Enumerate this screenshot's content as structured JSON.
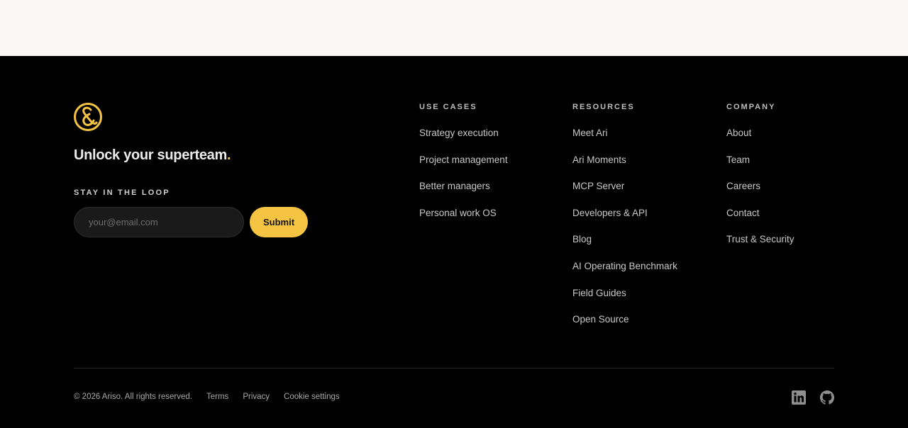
{
  "brand": {
    "tagline": "Unlock your superteam",
    "tagline_dot": ".",
    "accent": "#f5c443"
  },
  "newsletter": {
    "label": "STAY IN THE LOOP",
    "placeholder": "your@email.com",
    "submit_label": "Submit"
  },
  "columns": {
    "use_cases": {
      "heading": "USE CASES",
      "items": [
        "Strategy execution",
        "Project management",
        "Better managers",
        "Personal work OS"
      ]
    },
    "resources": {
      "heading": "RESOURCES",
      "items": [
        "Meet Ari",
        "Ari Moments",
        "MCP Server",
        "Developers & API",
        "Blog",
        "AI Operating Benchmark",
        "Field Guides",
        "Open Source"
      ]
    },
    "company": {
      "heading": "COMPANY",
      "items": [
        "About",
        "Team",
        "Careers",
        "Contact",
        "Trust & Security"
      ]
    }
  },
  "legal": {
    "copyright": "© 2026 Ariso. All rights reserved.",
    "links": [
      "Terms",
      "Privacy",
      "Cookie settings"
    ]
  },
  "social": {
    "icons": [
      "linkedin-icon",
      "github-icon"
    ]
  }
}
